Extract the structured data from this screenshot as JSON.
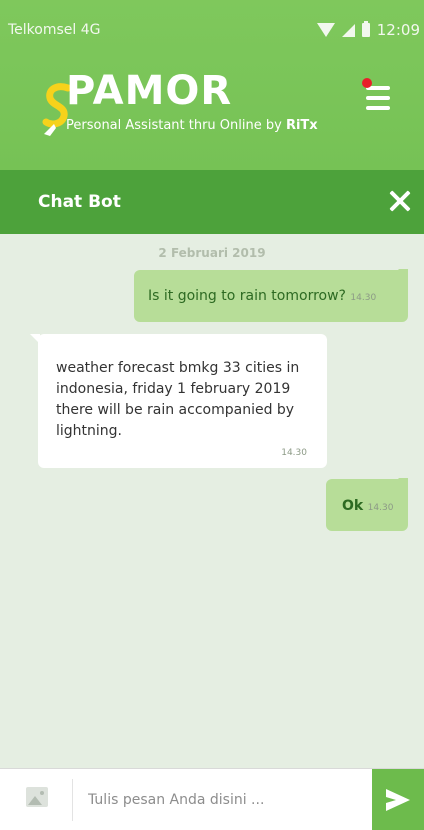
{
  "status_bar": {
    "carrier": "Telkomsel 4G",
    "time": "12:09"
  },
  "header": {
    "logo_text": "PAMOR",
    "tagline_prefix": "Personal Assistant thru Online by ",
    "tagline_brand": "RiTx"
  },
  "chat_bar": {
    "title": "Chat Bot"
  },
  "conversation": {
    "date": "2 Februari 2019",
    "messages": [
      {
        "side": "out",
        "text": "Is it going to rain tomorrow?",
        "time": "14.30"
      },
      {
        "side": "in",
        "text": "weather forecast bmkg 33 cities in indonesia, friday 1 february 2019 there will be rain accompanied by lightning.",
        "time": "14.30"
      },
      {
        "side": "out",
        "text": "Ok",
        "time": "14.30"
      }
    ]
  },
  "input": {
    "placeholder": "Tulis pesan Anda disini ..."
  },
  "icons": {
    "wifi": "wifi-icon",
    "signal": "signal-icon",
    "battery": "battery-icon",
    "menu": "hamburger-menu-icon",
    "close": "close-icon",
    "attach_image": "image-icon",
    "send": "send-icon"
  },
  "colors": {
    "header_green": "#7cc65a",
    "chatbar_green": "#4da23b",
    "outgoing_bubble": "#b7dd98",
    "incoming_bubble": "#ffffff",
    "chat_background": "#e5eee2",
    "send_button": "#6dbb4c",
    "notification_dot": "#e8202a"
  }
}
